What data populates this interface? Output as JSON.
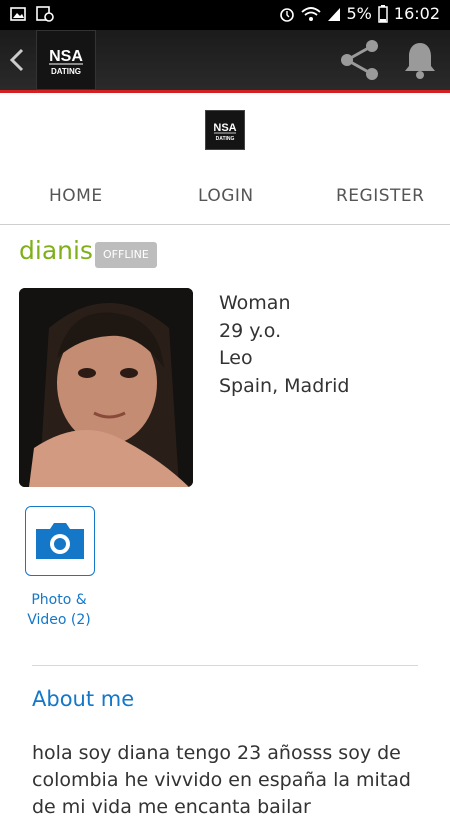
{
  "status_bar": {
    "battery_percent": "5%",
    "time": "16:02",
    "icons": [
      "gallery-icon",
      "screenshot-icon",
      "alarm-icon",
      "wifi-icon",
      "signal-icon",
      "battery-icon"
    ]
  },
  "app_bar": {
    "logo_line1": "NSA",
    "logo_line2": "DATING",
    "icons": [
      "back-icon",
      "share-icon",
      "bell-icon"
    ]
  },
  "nav": {
    "home": "HOME",
    "login": "LOGIN",
    "register": "REGISTER"
  },
  "profile": {
    "name": "dianis",
    "status": "OFFLINE",
    "gender": "Woman",
    "age": "29 y.o.",
    "sign": "Leo",
    "location": "Spain, Madrid"
  },
  "media": {
    "label_line1": "Photo &",
    "label_line2": "Video (2)"
  },
  "about": {
    "title": "About me",
    "text": "hola soy diana tengo 23 añosss soy de colombia he vivvido en españa la mitad de mi vida me encanta bailar"
  },
  "colors": {
    "accent_green": "#7fb01a",
    "accent_blue": "#1477c8",
    "app_bar_line": "#d32020",
    "badge_gray": "#bdbdbd"
  }
}
